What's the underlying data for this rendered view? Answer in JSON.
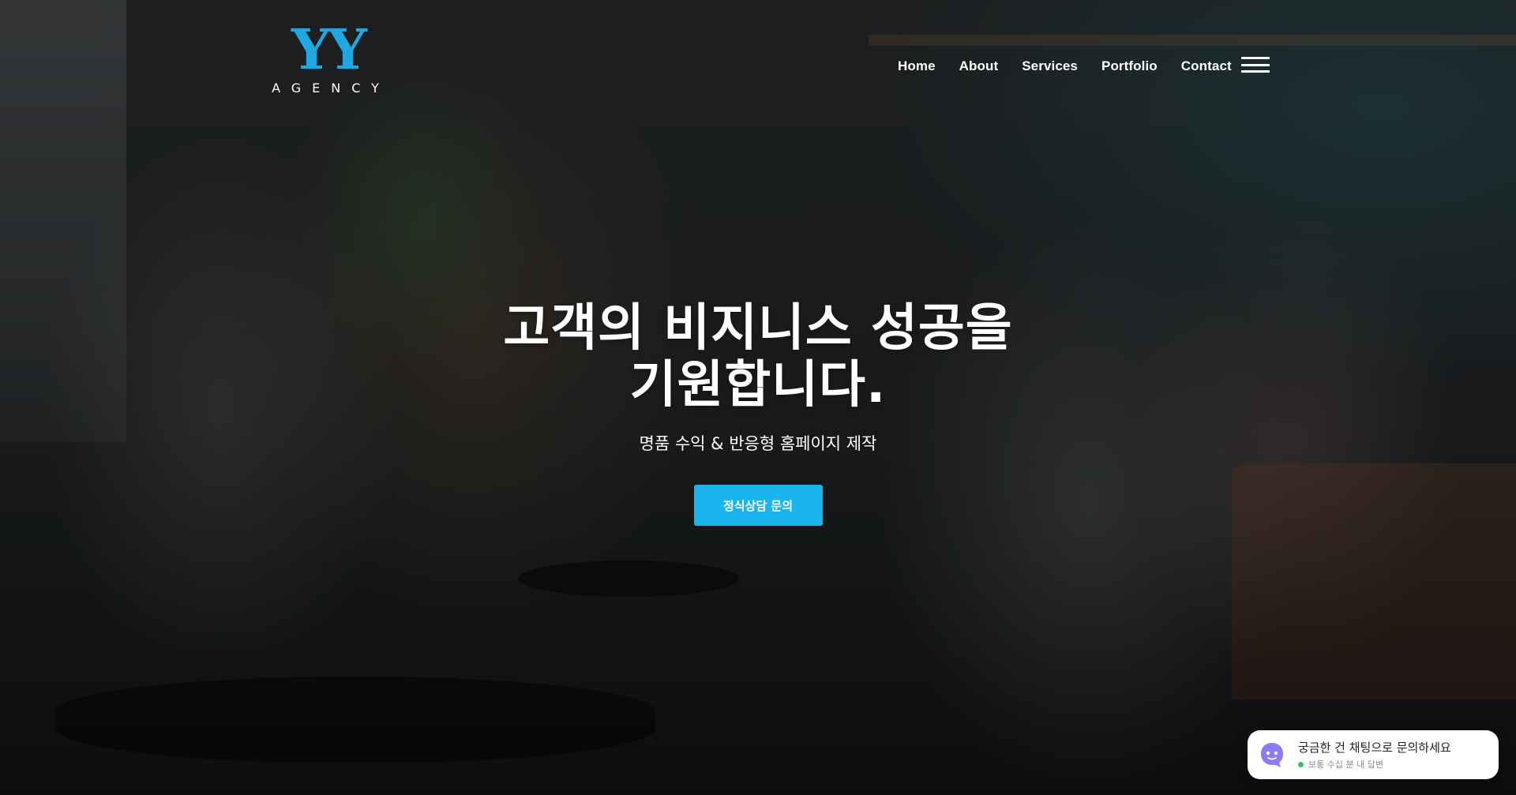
{
  "logo": {
    "mark": "YY",
    "sub": "AGENCY"
  },
  "nav": {
    "items": [
      {
        "label": "Home"
      },
      {
        "label": "About"
      },
      {
        "label": "Services"
      },
      {
        "label": "Portfolio"
      },
      {
        "label": "Contact"
      }
    ],
    "menu_icon": "hamburger-icon"
  },
  "hero": {
    "title_line1": "고객의 비지니스 성공을",
    "title_line2": "기원합니다.",
    "subtitle": "명품 수익 & 반응형 홈페이지 제작",
    "cta_label": "정식상담 문의"
  },
  "chat": {
    "title": "궁금한 건 채팅으로 문의하세요",
    "status": "보통 수십 분 내 답변",
    "icon": "chat-bot-icon"
  },
  "colors": {
    "brand": "#1ea7e1",
    "cta": "#1ab5ee",
    "online": "#2fc36b",
    "chat_avatar": "#8b7cf6"
  }
}
